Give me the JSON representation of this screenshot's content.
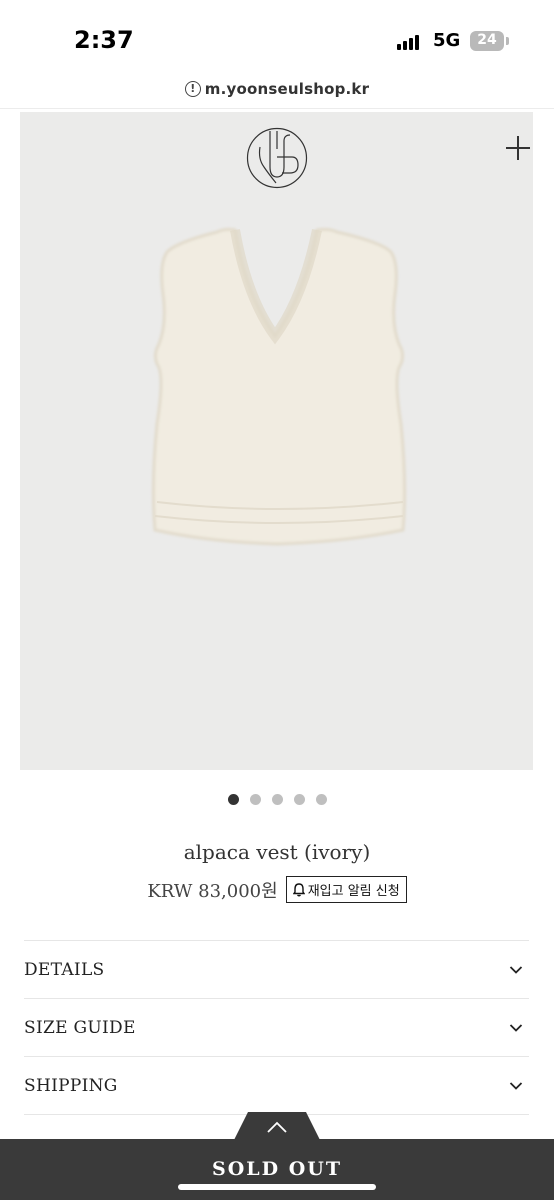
{
  "status_bar": {
    "time": "2:37",
    "network": "5G",
    "battery": "24"
  },
  "browser": {
    "url": "m.yoonseulshop.kr"
  },
  "gallery": {
    "image_count": 5,
    "active_index": 0
  },
  "product": {
    "title": "alpaca vest (ivory)",
    "price": "KRW 83,000원",
    "restock_label": "재입고 알림 신청"
  },
  "accordion": [
    {
      "label": "DETAILS"
    },
    {
      "label": "SIZE GUIDE"
    },
    {
      "label": "SHIPPING"
    }
  ],
  "bottom_bar": {
    "label": "SOLD OUT"
  },
  "colors": {
    "bar": "#3a3a3a",
    "image_bg": "#ebebea",
    "vest": "#f1ece1"
  }
}
